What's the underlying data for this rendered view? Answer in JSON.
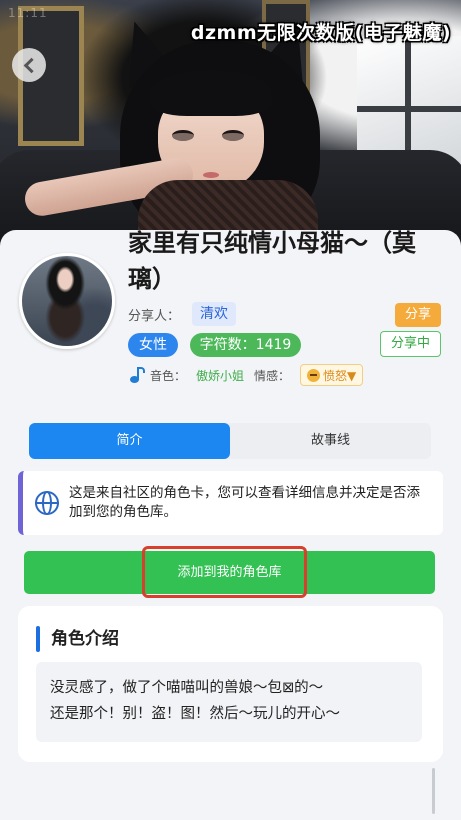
{
  "status_time": "11:11",
  "watermark": "dzmm无限次数版(电子魅魔)",
  "character": {
    "name": "家里有只纯情小母猫～（莫璃）",
    "sharer_label": "分享人：",
    "sharer_name": "清欢",
    "share_button": "分享",
    "gender": "女性",
    "char_count": "字符数：1419",
    "sharing_status_button": "分享中",
    "voice_label": "音色：",
    "voice_value": "傲娇小姐",
    "emotion_label": "情感：",
    "emotion_value": "愤怒▼"
  },
  "tabs": [
    {
      "label": "简介",
      "active": true
    },
    {
      "label": "故事线",
      "active": false
    }
  ],
  "notice": {
    "text": "这是来自社区的角色卡，您可以查看详细信息并决定是否添加到您的角色库。"
  },
  "add_button": "添加到我的角色库",
  "intro": {
    "title": "角色介绍",
    "line1": "没灵感了，做了个喵喵叫的兽娘～包⊠的～",
    "line2": "还是那个！别！盗！图！然后～玩儿的开心～"
  },
  "colors": {
    "accent_blue": "#1c87f0",
    "green": "#33c153",
    "orange": "#f4ab3c",
    "highlight_red": "#d8402e"
  }
}
